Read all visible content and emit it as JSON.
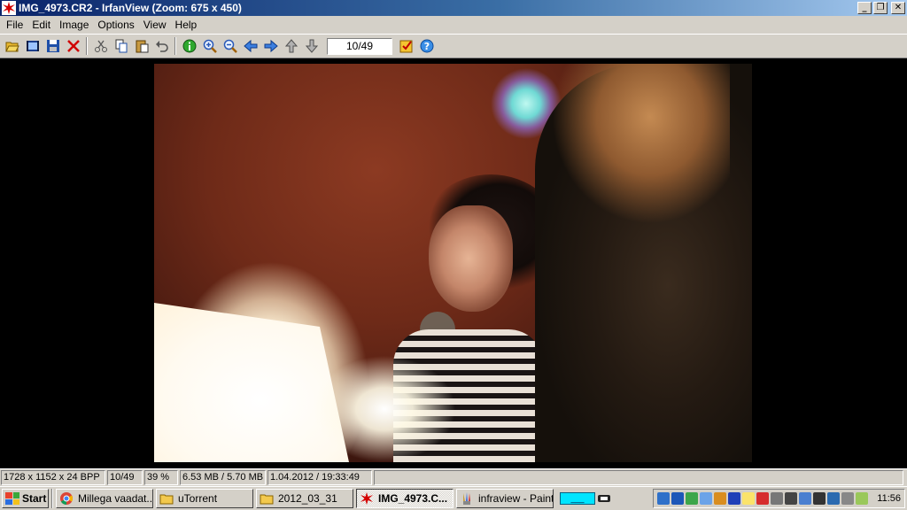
{
  "window": {
    "title": "IMG_4973.CR2 - IrfanView (Zoom: 675 x 450)",
    "controls": {
      "minimize": "_",
      "maximize": "❐",
      "close": "✕"
    }
  },
  "menu": {
    "items": [
      "File",
      "Edit",
      "Image",
      "Options",
      "View",
      "Help"
    ]
  },
  "toolbar": {
    "buttons": [
      "open-folder-icon",
      "slideshow-icon",
      "save-icon",
      "delete-icon",
      "cut-icon",
      "copy-icon",
      "paste-icon",
      "undo-icon",
      "info-icon",
      "zoom-in-icon",
      "zoom-out-icon",
      "previous-icon",
      "next-icon",
      "first-icon",
      "last-icon"
    ],
    "page_indicator": "10/49",
    "extra_buttons": [
      "properties-icon",
      "help-icon"
    ]
  },
  "status": {
    "dimensions": "1728 x 1152 x 24 BPP",
    "position": "10/49",
    "zoom": "39 %",
    "size": "6.53 MB / 5.70 MB",
    "date": "1.04.2012 / 19:33:49"
  },
  "taskbar": {
    "start_label": "Start",
    "tasks": [
      {
        "label": "Millega vaadat...",
        "icon": "chrome-icon",
        "active": false
      },
      {
        "label": "uTorrent",
        "icon": "folder-icon",
        "active": false
      },
      {
        "label": "2012_03_31",
        "icon": "folder-icon",
        "active": false
      },
      {
        "label": "IMG_4973.C...",
        "icon": "irfanview-icon",
        "active": true
      },
      {
        "label": "infraview - Paint",
        "icon": "paint-icon",
        "active": false
      }
    ],
    "clock": "11:56"
  },
  "colors": {
    "titlebar_start": "#0a246a",
    "titlebar_end": "#a6caf0",
    "chrome_gray": "#d4d0c8"
  }
}
